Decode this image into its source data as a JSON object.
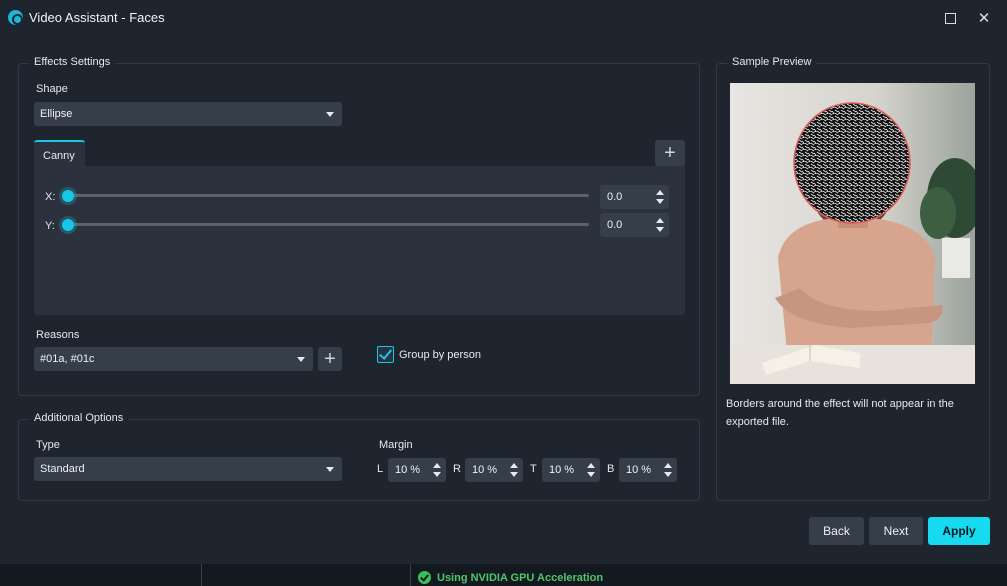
{
  "window": {
    "title": "Video Assistant - Faces",
    "maximize_icon": "maximize-icon",
    "close_icon": "close-icon",
    "close_glyph": "✕"
  },
  "effects": {
    "group_title": "Effects Settings",
    "shape_label": "Shape",
    "shape_value": "Ellipse",
    "tab_label": "Canny",
    "add_tab_glyph": "+",
    "x_label": "X:",
    "x_value": "0.0",
    "y_label": "Y:",
    "y_value": "0.0",
    "reasons_label": "Reasons",
    "reasons_value": "#01a, #01c",
    "add_reason_glyph": "+",
    "group_by_label": "Group by person",
    "group_by_checked": true
  },
  "additional": {
    "group_title": "Additional Options",
    "type_label": "Type",
    "type_value": "Standard",
    "margin_label": "Margin",
    "margins": [
      {
        "key": "L",
        "value": "10 %"
      },
      {
        "key": "R",
        "value": "10 %"
      },
      {
        "key": "T",
        "value": "10 %"
      },
      {
        "key": "B",
        "value": "10 %"
      }
    ]
  },
  "preview": {
    "group_title": "Sample Preview",
    "note": "Borders around the effect will not appear in the exported file."
  },
  "buttons": {
    "back": "Back",
    "next": "Next",
    "apply": "Apply"
  },
  "status": {
    "text": "Using NVIDIA GPU Acceleration"
  },
  "colors": {
    "accent": "#17c7e8",
    "apply_button": "#17d9ef",
    "status_ok": "#37c15a"
  }
}
